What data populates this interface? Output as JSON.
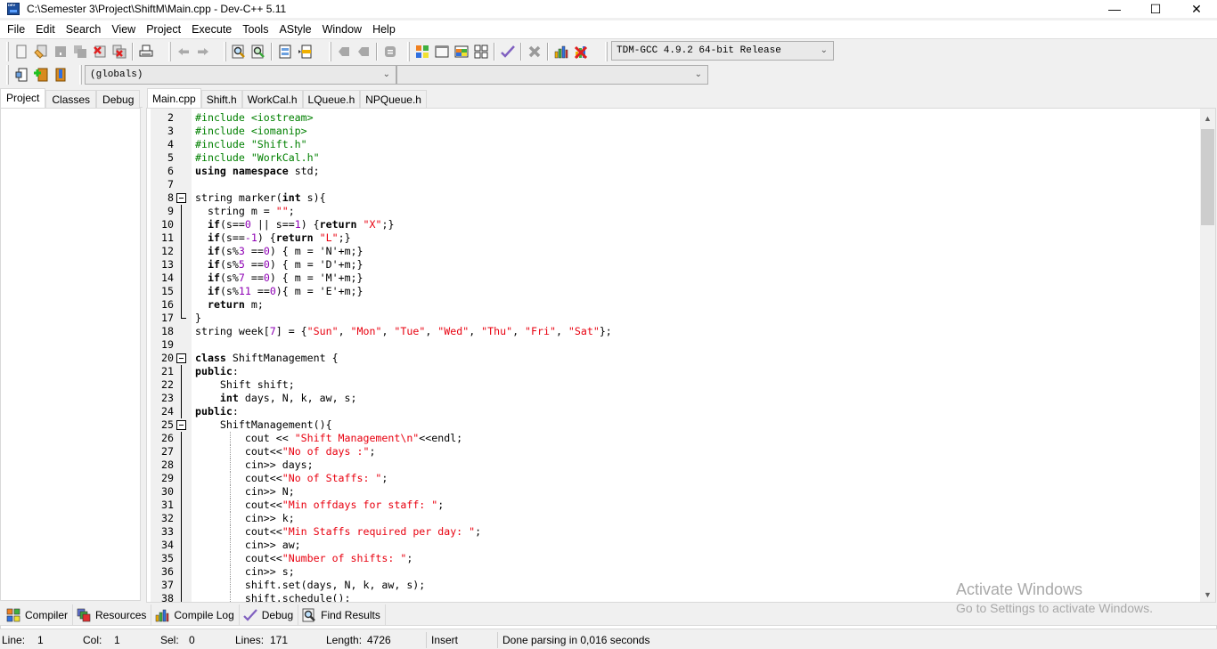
{
  "window": {
    "title": "C:\\Semester 3\\Project\\ShiftM\\Main.cpp - Dev-C++ 5.11",
    "minimize": "—",
    "maximize": "☐",
    "close": "✕"
  },
  "menu": [
    "File",
    "Edit",
    "Search",
    "View",
    "Project",
    "Execute",
    "Tools",
    "AStyle",
    "Window",
    "Help"
  ],
  "toolbar": {
    "compiler_select": "TDM-GCC 4.9.2 64-bit Release",
    "scope_select": "(globals)",
    "symbol_select": "",
    "icons": [
      "new-file-icon",
      "open-file-icon",
      "save-icon",
      "save-all-icon",
      "close-file-icon",
      "close-all-icon",
      "print-icon",
      "undo-icon",
      "redo-icon",
      "find-icon",
      "replace-icon",
      "indent-icon",
      "unindent-icon",
      "goto-back-icon",
      "goto-forward-icon",
      "bookmark-icon",
      "compile-icon",
      "run-icon",
      "compile-run-icon",
      "rebuild-icon",
      "syntax-check-icon",
      "stop-icon",
      "profile-icon",
      "delete-profile-icon"
    ],
    "project_icons": [
      "new-project-icon",
      "add-to-project-icon",
      "remove-from-project-icon"
    ]
  },
  "left_panel": {
    "tabs": [
      "Project",
      "Classes",
      "Debug"
    ],
    "active_tab": "Project"
  },
  "editor": {
    "tabs": [
      "Main.cpp",
      "Shift.h",
      "WorkCal.h",
      "LQueue.h",
      "NPQueue.h"
    ],
    "active_tab": "Main.cpp",
    "lines": [
      {
        "n": "2",
        "code": "#include <iostream>"
      },
      {
        "n": "3",
        "code": "#include <iomanip>"
      },
      {
        "n": "4",
        "code": "#include \"Shift.h\""
      },
      {
        "n": "5",
        "code": "#include \"WorkCal.h\""
      },
      {
        "n": "6",
        "code": "using namespace std;"
      },
      {
        "n": "7",
        "code": ""
      },
      {
        "n": "8",
        "code": "string marker(int s){"
      },
      {
        "n": "9",
        "code": "  string m = \"\";"
      },
      {
        "n": "10",
        "code": "  if(s==0 || s==1) {return \"X\";}"
      },
      {
        "n": "11",
        "code": "  if(s==-1) {return \"L\";}"
      },
      {
        "n": "12",
        "code": "  if(s%3 ==0) { m = 'N'+m;}"
      },
      {
        "n": "13",
        "code": "  if(s%5 ==0) { m = 'D'+m;}"
      },
      {
        "n": "14",
        "code": "  if(s%7 ==0) { m = 'M'+m;}"
      },
      {
        "n": "15",
        "code": "  if(s%11 ==0){ m = 'E'+m;}"
      },
      {
        "n": "16",
        "code": "  return m;"
      },
      {
        "n": "17",
        "code": "}"
      },
      {
        "n": "18",
        "code": "string week[7] = {\"Sun\", \"Mon\", \"Tue\", \"Wed\", \"Thu\", \"Fri\", \"Sat\"};"
      },
      {
        "n": "19",
        "code": ""
      },
      {
        "n": "20",
        "code": "class ShiftManagement {"
      },
      {
        "n": "21",
        "code": "public:"
      },
      {
        "n": "22",
        "code": "    Shift shift;"
      },
      {
        "n": "23",
        "code": "    int days, N, k, aw, s;"
      },
      {
        "n": "24",
        "code": "public:"
      },
      {
        "n": "25",
        "code": "    ShiftManagement(){"
      },
      {
        "n": "26",
        "code": "        cout << \"Shift Management\\n\"<<endl;"
      },
      {
        "n": "27",
        "code": "        cout<<\"No of days :\";"
      },
      {
        "n": "28",
        "code": "        cin>> days;"
      },
      {
        "n": "29",
        "code": "        cout<<\"No of Staffs: \";"
      },
      {
        "n": "30",
        "code": "        cin>> N;"
      },
      {
        "n": "31",
        "code": "        cout<<\"Min offdays for staff: \";"
      },
      {
        "n": "32",
        "code": "        cin>> k;"
      },
      {
        "n": "33",
        "code": "        cout<<\"Min Staffs required per day: \";"
      },
      {
        "n": "34",
        "code": "        cin>> aw;"
      },
      {
        "n": "35",
        "code": "        cout<<\"Number of shifts: \";"
      },
      {
        "n": "36",
        "code": "        cin>> s;"
      },
      {
        "n": "37",
        "code": "        shift.set(days, N, k, aw, s);"
      },
      {
        "n": "38",
        "code": "        shift.schedule();"
      }
    ],
    "scroll_position_fraction": 0.0
  },
  "bottom_tabs": [
    {
      "label": "Compiler",
      "icon": "compiler-grid-icon"
    },
    {
      "label": "Resources",
      "icon": "resources-icon"
    },
    {
      "label": "Compile Log",
      "icon": "compile-log-chart-icon"
    },
    {
      "label": "Debug",
      "icon": "debug-check-icon"
    },
    {
      "label": "Find Results",
      "icon": "find-results-icon"
    }
  ],
  "status": {
    "line_label": "Line:",
    "line": "1",
    "col_label": "Col:",
    "col": "1",
    "sel_label": "Sel:",
    "sel": "0",
    "lines_label": "Lines:",
    "lines": "171",
    "length_label": "Length:",
    "length": "4726",
    "mode": "Insert",
    "message": "Done parsing in 0,016 seconds"
  },
  "watermark": {
    "title": "Activate Windows",
    "subtitle": "Go to Settings to activate Windows."
  },
  "colors": {
    "string": "#e8000f",
    "preprocessor": "#008000",
    "number": "#8e00b4",
    "keyword": "#000000"
  }
}
